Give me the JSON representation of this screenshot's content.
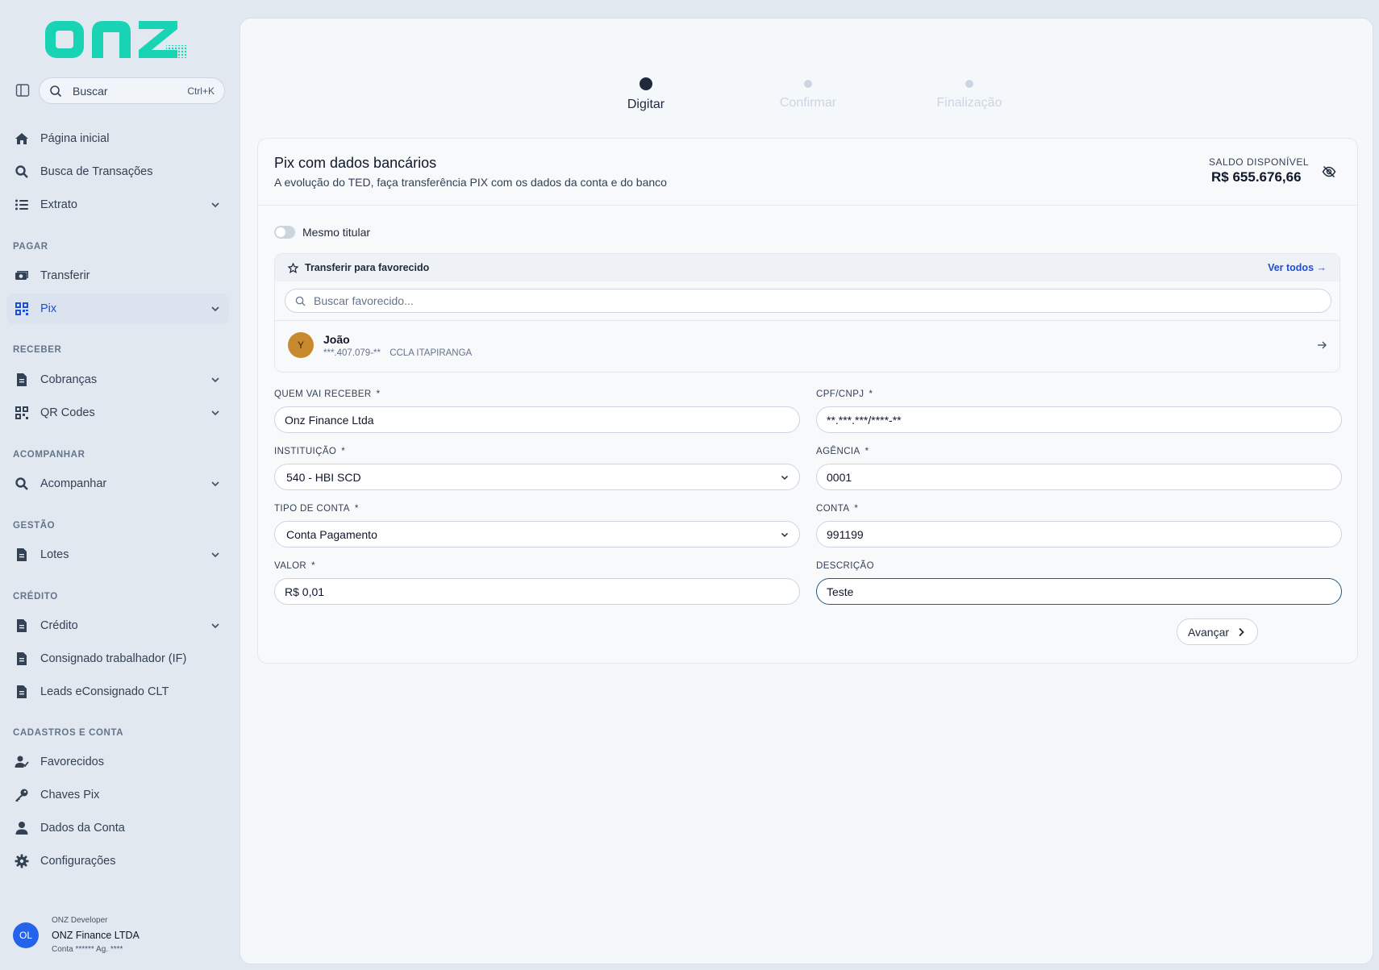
{
  "brand": {
    "logo_text": "onz",
    "accent": "#19d4b4"
  },
  "search": {
    "label": "Buscar",
    "shortcut": "Ctrl+K"
  },
  "sidebar": {
    "items": [
      {
        "label": "Página inicial",
        "icon": "home-icon"
      },
      {
        "label": "Busca de Transações",
        "icon": "search-icon"
      },
      {
        "label": "Extrato",
        "icon": "list-icon"
      }
    ],
    "sections": [
      {
        "title": "PAGAR",
        "items": [
          {
            "label": "Transferir",
            "icon": "money-icon"
          },
          {
            "label": "Pix",
            "icon": "qr-icon"
          }
        ]
      },
      {
        "title": "RECEBER",
        "items": [
          {
            "label": "Cobranças",
            "icon": "document-icon"
          },
          {
            "label": "QR Codes",
            "icon": "qr-icon"
          }
        ]
      },
      {
        "title": "ACOMPANHAR",
        "items": [
          {
            "label": "Acompanhar",
            "icon": "search-icon"
          }
        ]
      },
      {
        "title": "GESTÃO",
        "items": [
          {
            "label": "Lotes",
            "icon": "document-icon"
          }
        ]
      },
      {
        "title": "CRÉDITO",
        "items": [
          {
            "label": "Crédito",
            "icon": "document-icon"
          },
          {
            "label": "Consignado trabalhador (IF)",
            "icon": "document-icon"
          },
          {
            "label": "Leads eConsignado CLT",
            "icon": "document-icon"
          }
        ]
      },
      {
        "title": "CADASTROS E CONTA",
        "items": [
          {
            "label": "Favorecidos",
            "icon": "user-check-icon"
          },
          {
            "label": "Chaves Pix",
            "icon": "key-icon"
          },
          {
            "label": "Dados da Conta",
            "icon": "user-icon"
          },
          {
            "label": "Configurações",
            "icon": "gear-icon"
          }
        ]
      }
    ]
  },
  "user": {
    "initials": "OL",
    "role": "ONZ Developer",
    "company": "ONZ Finance LTDA",
    "account": "Conta ****** Ag. ****"
  },
  "stepper": [
    {
      "label": "Digitar",
      "state": "active"
    },
    {
      "label": "Confirmar",
      "state": "pending"
    },
    {
      "label": "Finalização",
      "state": "pending"
    }
  ],
  "card": {
    "title": "Pix com dados bancários",
    "subtitle": "A evolução do TED, faça transferência PIX com os dados da conta e do banco",
    "balance_label": "SALDO DISPONÍVEL",
    "balance_value": "R$ 655.676,66"
  },
  "same_holder": {
    "label": "Mesmo titular",
    "checked": false
  },
  "favorites": {
    "title": "Transferir para favorecido",
    "see_all": "Ver todos →",
    "search_placeholder": "Buscar favorecido...",
    "items": [
      {
        "initial": "Y",
        "name": "João",
        "doc": "***.407.079-**",
        "bank": "CCLA ITAPIRANGA"
      }
    ]
  },
  "form": {
    "receiver": {
      "label": "QUEM VAI RECEBER",
      "required": "*",
      "value": "Onz Finance Ltda"
    },
    "document": {
      "label": "CPF/CNPJ",
      "required": "*",
      "value": "**.***.***/****-**"
    },
    "institution": {
      "label": "INSTITUIÇÃO",
      "required": "*",
      "value": "540 - HBI SCD"
    },
    "agency": {
      "label": "AGÊNCIA",
      "required": "*",
      "value": "0001"
    },
    "account_type": {
      "label": "TIPO DE CONTA",
      "required": "*",
      "value": "Conta Pagamento"
    },
    "account": {
      "label": "CONTA",
      "required": "*",
      "value": "991199"
    },
    "amount": {
      "label": "VALOR",
      "required": "*",
      "value": "R$ 0,01"
    },
    "description": {
      "label": "DESCRIÇÃO",
      "value": "Teste"
    }
  },
  "actions": {
    "next_label": "Avançar"
  }
}
